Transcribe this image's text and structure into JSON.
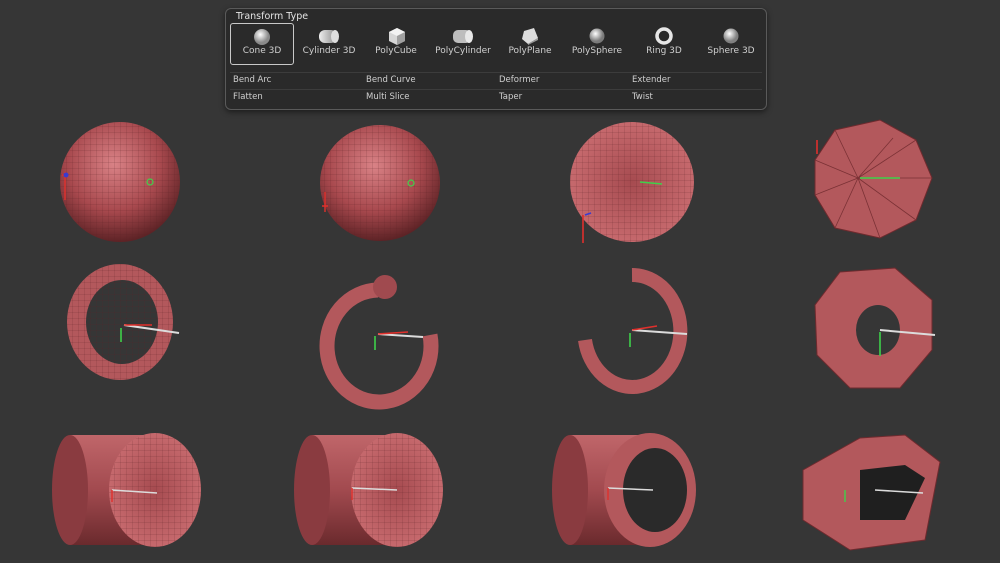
{
  "panel": {
    "title": "Transform Type",
    "tools": [
      {
        "label": "Cone 3D",
        "icon": "cone-icon",
        "selected": true
      },
      {
        "label": "Cylinder 3D",
        "icon": "cylinder-icon",
        "selected": false
      },
      {
        "label": "PolyCube",
        "icon": "cube-icon",
        "selected": false
      },
      {
        "label": "PolyCylinder",
        "icon": "polycylinder-icon",
        "selected": false
      },
      {
        "label": "PolyPlane",
        "icon": "polyplane-icon",
        "selected": false
      },
      {
        "label": "PolySphere",
        "icon": "sphere-icon",
        "selected": false
      },
      {
        "label": "Ring 3D",
        "icon": "ring-icon",
        "selected": false
      },
      {
        "label": "Sphere 3D",
        "icon": "sphere3d-icon",
        "selected": false
      }
    ],
    "deformers": [
      [
        "Bend Arc",
        "Bend Curve",
        "Deformer",
        "Extender"
      ],
      [
        "Flatten",
        "Multi Slice",
        "Taper",
        "Twist"
      ]
    ]
  },
  "colors": {
    "background": "#363636",
    "mesh": "#b3585c",
    "mesh_dark": "#7a3135",
    "gizmo_green": "#3fd14a",
    "gizmo_red": "#e0302c",
    "gizmo_blue": "#3a3ad0"
  }
}
